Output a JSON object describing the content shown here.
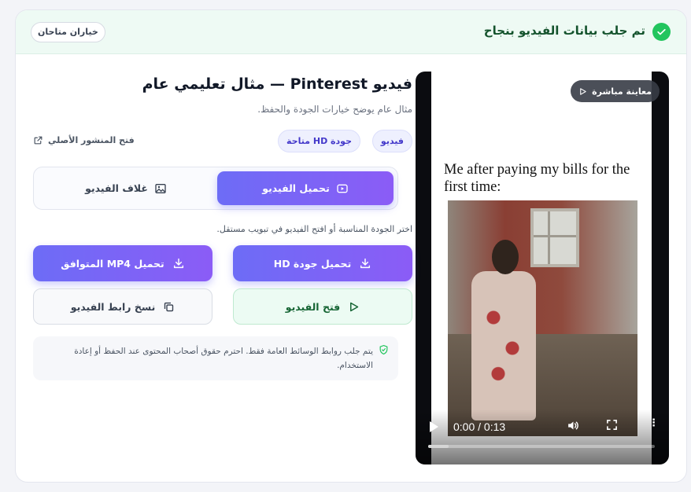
{
  "header": {
    "success_text": "تم جلب بيانات الفيديو بنجاح",
    "options_label": "خياران متاحان"
  },
  "preview": {
    "live_badge": "معاينة مباشرة",
    "caption": "Me after paying my bills for the first time:",
    "time": "0:00 / 0:13",
    "progress": 0.09
  },
  "info": {
    "title": "فيديو Pinterest — مثال تعليمي عام",
    "subtitle": "مثال عام يوضح خيارات الجودة والحفظ.",
    "tags": [
      "فيديو",
      "جودة HD متاحة"
    ],
    "origin_link": "فتح المنشور الأصلي"
  },
  "tabs": {
    "download": "تحميل الفيديو",
    "cover": "غلاف الفيديو"
  },
  "hint": "اختر الجودة المناسبة أو افتح الفيديو في تبويب مستقل.",
  "buttons": {
    "download_hd": "تحميل جودة HD",
    "download_mp4": "تحميل MP4 المتوافق",
    "open_video": "فتح الفيديو",
    "copy_link": "نسخ رابط الفيديو"
  },
  "notice": "يتم جلب روابط الوسائط العامة فقط. احترم حقوق أصحاب المحتوى عند الحفظ أو إعادة الاستخدام.",
  "colors": {
    "accent": "#6d6cf6",
    "success": "#22c55e"
  }
}
